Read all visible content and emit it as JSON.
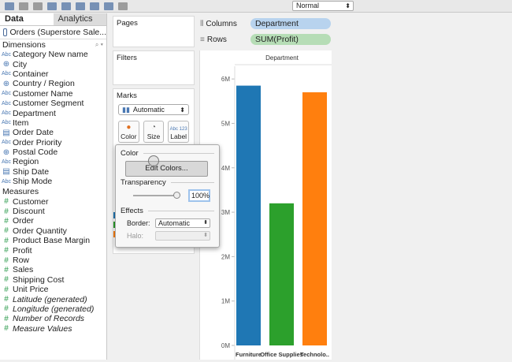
{
  "toolbar": {
    "format_select": "Normal"
  },
  "datapane": {
    "tabs": [
      "Data",
      "Analytics"
    ],
    "datasource": "Orders (Superstore Sale...",
    "dimensions_header": "Dimensions",
    "measures_header": "Measures",
    "dimensions": [
      {
        "type": "Abc",
        "name": "Category New name"
      },
      {
        "type": "geo",
        "name": "City"
      },
      {
        "type": "Abc",
        "name": "Container"
      },
      {
        "type": "geo",
        "name": "Country / Region"
      },
      {
        "type": "Abc",
        "name": "Customer Name"
      },
      {
        "type": "Abc",
        "name": "Customer Segment"
      },
      {
        "type": "Abc",
        "name": "Department"
      },
      {
        "type": "Abc",
        "name": "Item"
      },
      {
        "type": "date",
        "name": "Order Date"
      },
      {
        "type": "Abc",
        "name": "Order Priority"
      },
      {
        "type": "geo",
        "name": "Postal Code"
      },
      {
        "type": "Abc",
        "name": "Region"
      },
      {
        "type": "date",
        "name": "Ship Date"
      },
      {
        "type": "Abc",
        "name": "Ship Mode"
      }
    ],
    "measures": [
      {
        "name": "Customer",
        "italic": false
      },
      {
        "name": "Discount",
        "italic": false
      },
      {
        "name": "Order",
        "italic": false
      },
      {
        "name": "Order Quantity",
        "italic": false
      },
      {
        "name": "Product Base Margin",
        "italic": false
      },
      {
        "name": "Profit",
        "italic": false
      },
      {
        "name": "Row",
        "italic": false
      },
      {
        "name": "Sales",
        "italic": false
      },
      {
        "name": "Shipping Cost",
        "italic": false
      },
      {
        "name": "Unit Price",
        "italic": false
      },
      {
        "name": "Latitude (generated)",
        "italic": true
      },
      {
        "name": "Longitude (generated)",
        "italic": true
      },
      {
        "name": "Number of Records",
        "italic": true
      },
      {
        "name": "Measure Values",
        "italic": true
      }
    ]
  },
  "cards": {
    "pages": "Pages",
    "filters": "Filters",
    "marks": "Marks",
    "marks_type": "Automatic",
    "color_btn": "Color",
    "size_btn": "Size",
    "label_btn": "Label",
    "label_icon": "Abc 123"
  },
  "shelves": {
    "columns_label": "Columns",
    "columns_pill": "Department",
    "rows_label": "Rows",
    "rows_pill": "SUM(Profit)"
  },
  "colors": {
    "dim_pill": "#b8d3ee",
    "meas_pill": "#b6ddb6"
  },
  "popup": {
    "color_header": "Color",
    "edit_colors": "Edit Colors...",
    "transparency_header": "Transparency",
    "transparency_value": "100%",
    "effects_header": "Effects",
    "border_label": "Border:",
    "border_value": "Automatic",
    "halo_label": "Halo:",
    "halo_value": ""
  },
  "chart_data": {
    "type": "bar",
    "header": "Department",
    "categories": [
      "Furniture",
      "Office Supplies",
      "Technolo.."
    ],
    "values": [
      5.85,
      3.2,
      5.7
    ],
    "colors": [
      "#1f77b4",
      "#2ca02c",
      "#ff7f0e"
    ],
    "yticks": [
      {
        "v": 0,
        "label": "0M"
      },
      {
        "v": 1,
        "label": "1M"
      },
      {
        "v": 2,
        "label": "2M"
      },
      {
        "v": 3,
        "label": "3M"
      },
      {
        "v": 4,
        "label": "4M"
      },
      {
        "v": 5,
        "label": "5M"
      },
      {
        "v": 6,
        "label": "6M"
      }
    ],
    "ylim": [
      0,
      6.18
    ]
  }
}
